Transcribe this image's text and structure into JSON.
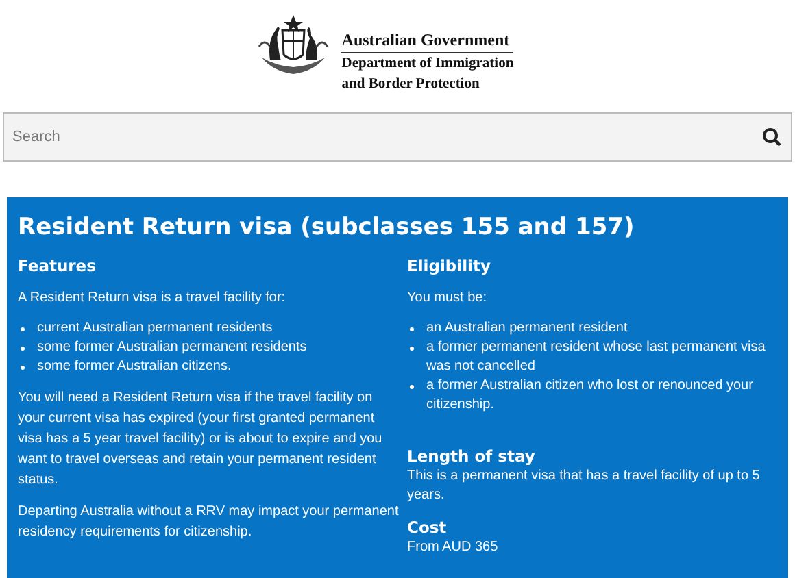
{
  "header": {
    "government": "Australian Government",
    "department_lines": [
      "Department of Immigration",
      "and Border Protection"
    ]
  },
  "search": {
    "placeholder": "Search"
  },
  "panel": {
    "title": "Resident Return visa (subclasses 155 and 157)",
    "columns": [
      {
        "sections": [
          {
            "heading": "Features",
            "blocks": [
              {
                "kind": "paragraph",
                "text": "A Resident Return visa is a travel facility for:"
              },
              {
                "kind": "list",
                "items": [
                  "current Australian permanent residents",
                  "some former Australian permanent residents",
                  "some former Australian citizens."
                ]
              },
              {
                "kind": "paragraph",
                "text": "You will need a Resident Return visa if the travel facility on your current visa has expired (your first granted permanent visa has a 5 year travel facility) or is about to expire and you want to travel overseas and retain your permanent resident status."
              },
              {
                "kind": "paragraph",
                "text": "Departing Australia without a RRV may impact your permanent residency requirements for citizenship."
              }
            ]
          }
        ]
      },
      {
        "sections": [
          {
            "heading": "Eligibility",
            "blocks": [
              {
                "kind": "paragraph",
                "text": "You must be:"
              },
              {
                "kind": "list",
                "items": [
                  "an Australian permanent resident",
                  "a former permanent resident whose last permanent visa was not cancelled",
                  "a former Australian citizen who lost or renounced your citizenship."
                ]
              }
            ]
          },
          {
            "heading": "Length of stay",
            "blocks": [
              {
                "kind": "line",
                "text": "This is a permanent visa that has a travel facility of up to 5 years."
              }
            ]
          },
          {
            "heading": "Cost",
            "blocks": [
              {
                "kind": "line",
                "text": "From AUD 365"
              }
            ]
          }
        ]
      }
    ]
  }
}
